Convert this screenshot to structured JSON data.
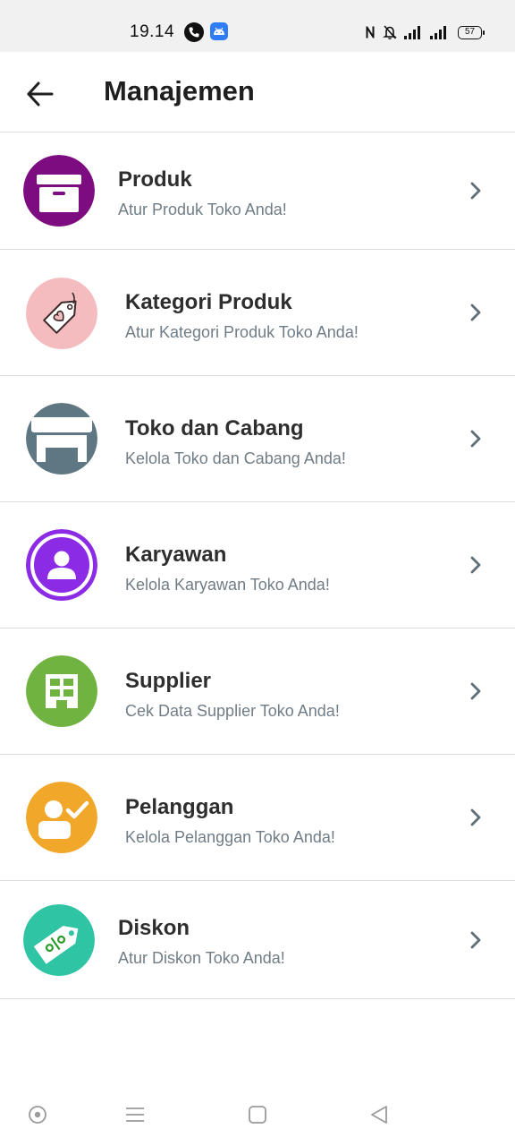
{
  "status_bar": {
    "time": "19.14",
    "battery": "57",
    "icons": [
      "phone-icon",
      "android-app-icon",
      "nfc-icon",
      "mute-icon",
      "signal-icon",
      "signal-icon",
      "battery-icon"
    ]
  },
  "header": {
    "title": "Manajemen",
    "back_icon": "arrow-left-icon"
  },
  "menu": [
    {
      "title": "Produk",
      "subtitle": "Atur Produk Toko Anda!",
      "icon": "box-icon",
      "icon_color": "#7c0c7f"
    },
    {
      "title": "Kategori Produk",
      "subtitle": "Atur Kategori Produk Toko Anda!",
      "icon": "tag-heart-icon",
      "icon_color": "#f4bcbf"
    },
    {
      "title": "Toko dan Cabang",
      "subtitle": "Kelola Toko dan Cabang Anda!",
      "icon": "store-icon",
      "icon_color": "#5f7782"
    },
    {
      "title": "Karyawan",
      "subtitle": "Kelola Karyawan Toko Anda!",
      "icon": "employee-icon",
      "icon_color": "#8b2be6"
    },
    {
      "title": "Supplier",
      "subtitle": "Cek Data Supplier Toko Anda!",
      "icon": "building-icon",
      "icon_color": "#70b340"
    },
    {
      "title": "Pelanggan",
      "subtitle": "Kelola Pelanggan Toko Anda!",
      "icon": "customer-check-icon",
      "icon_color": "#f1a82a"
    },
    {
      "title": "Diskon",
      "subtitle": "Atur Diskon Toko Anda!",
      "icon": "discount-tag-icon",
      "icon_color": "#2ec4a4"
    }
  ],
  "nav_bar": {
    "icons": [
      "assistant-icon",
      "menu-icon",
      "home-icon",
      "back-triangle-icon"
    ]
  }
}
